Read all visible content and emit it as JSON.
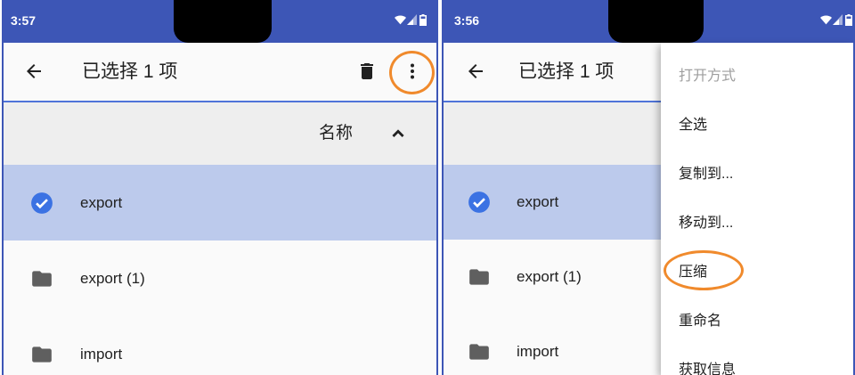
{
  "colors": {
    "status_bar": "#3d56b6",
    "selected_row": "#bccaec",
    "accent": "#3b72e3",
    "annotation": "#f08a2c"
  },
  "panels": [
    {
      "status_bar": {
        "time": "3:57",
        "icons": [
          "wifi-icon",
          "signal-icon",
          "battery-icon"
        ]
      },
      "toolbar": {
        "title": "已选择 1 项",
        "icons": [
          "back-arrow-icon",
          "delete-icon",
          "more-vert-icon"
        ]
      },
      "sort_header": {
        "label": "名称",
        "icon": "chevron-up-icon"
      },
      "files": [
        {
          "name": "export",
          "icon": "check-circle-icon",
          "selected": true
        },
        {
          "name": "export (1)",
          "icon": "folder-icon",
          "selected": false
        },
        {
          "name": "import",
          "icon": "folder-icon",
          "selected": false
        }
      ]
    },
    {
      "status_bar": {
        "time": "3:56",
        "icons": [
          "wifi-icon",
          "signal-icon",
          "battery-icon"
        ]
      },
      "toolbar": {
        "title": "已选择 1 项",
        "icons": [
          "back-arrow-icon"
        ]
      },
      "files": [
        {
          "name": "export",
          "icon": "check-circle-icon",
          "selected": true
        },
        {
          "name": "export (1)",
          "icon": "folder-icon",
          "selected": false
        },
        {
          "name": "import",
          "icon": "folder-icon",
          "selected": false
        }
      ]
    }
  ],
  "overflow_menu": {
    "items": [
      {
        "label": "打开方式",
        "disabled": true
      },
      {
        "label": "全选"
      },
      {
        "label": "复制到..."
      },
      {
        "label": "移动到..."
      },
      {
        "label": "压缩",
        "annotated": true
      },
      {
        "label": "重命名"
      },
      {
        "label": "获取信息"
      }
    ]
  }
}
